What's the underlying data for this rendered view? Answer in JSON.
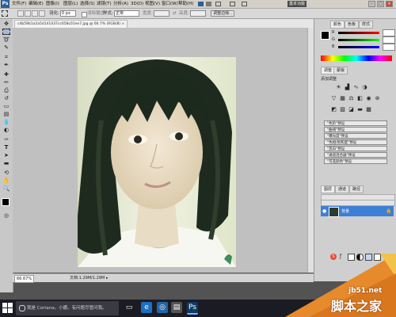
{
  "menubar": {
    "logo": "Ps",
    "items": [
      "文件(F)",
      "编辑(E)",
      "图像(I)",
      "图层(L)",
      "选择(S)",
      "滤镜(T)",
      "分析(A)",
      "3D(D)",
      "视图(V)",
      "窗口(W)",
      "帮助(H)"
    ],
    "workspace": "基本功能",
    "window_controls": [
      "–",
      "□",
      "×"
    ]
  },
  "options": {
    "feather_label": "羽化:",
    "feather_value": "0 px",
    "antialias_label": "消除锯齿",
    "style_label": "样式:",
    "style_value": "正常",
    "width_label": "宽度:",
    "height_label": "高度:",
    "refine_edge": "调整边缘..."
  },
  "document": {
    "tab_title": "c4b59b1a2a5d141437cc658c01ee7.jpg @ 66.7% (RGB/8) ×"
  },
  "status": {
    "zoom": "66.67%",
    "doc_size": "文档:1.29M/1.29M"
  },
  "panels": {
    "color_tabs": [
      "颜色",
      "色板",
      "样式"
    ],
    "adjust_tabs": [
      "调整",
      "蒙版"
    ],
    "adjust_title": "添加调整",
    "presets": [
      "\"色阶\"预设",
      "\"曲线\"预设",
      "\"曝光度\"预设",
      "\"色相/饱和度\"预设",
      "\"黑白\"预设",
      "\"通道混合器\"预设",
      "\"可选颜色\"预设"
    ],
    "layer_tabs": [
      "图层",
      "通道",
      "路径"
    ],
    "layer_name": "背景"
  },
  "taskbar": {
    "search_placeholder": "我是 Cortana。小娜。有问题尽管问我。"
  },
  "watermark": {
    "site": "jb51.net",
    "cn": "脚本之家"
  },
  "colors": {
    "accent_blue": "#3d7fd6",
    "canvas_bg": "#c0c0c0",
    "watermark_orange": "#e78a2b"
  }
}
